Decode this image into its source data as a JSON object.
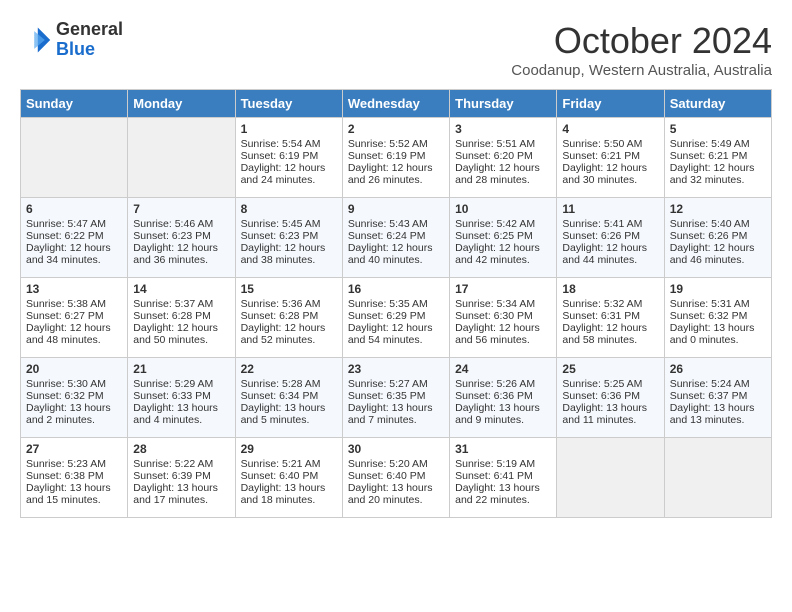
{
  "header": {
    "logo_line1": "General",
    "logo_line2": "Blue",
    "month_title": "October 2024",
    "subtitle": "Coodanup, Western Australia, Australia"
  },
  "days_of_week": [
    "Sunday",
    "Monday",
    "Tuesday",
    "Wednesday",
    "Thursday",
    "Friday",
    "Saturday"
  ],
  "weeks": [
    [
      {
        "day": "",
        "content": ""
      },
      {
        "day": "",
        "content": ""
      },
      {
        "day": "1",
        "content": "Sunrise: 5:54 AM\nSunset: 6:19 PM\nDaylight: 12 hours\nand 24 minutes."
      },
      {
        "day": "2",
        "content": "Sunrise: 5:52 AM\nSunset: 6:19 PM\nDaylight: 12 hours\nand 26 minutes."
      },
      {
        "day": "3",
        "content": "Sunrise: 5:51 AM\nSunset: 6:20 PM\nDaylight: 12 hours\nand 28 minutes."
      },
      {
        "day": "4",
        "content": "Sunrise: 5:50 AM\nSunset: 6:21 PM\nDaylight: 12 hours\nand 30 minutes."
      },
      {
        "day": "5",
        "content": "Sunrise: 5:49 AM\nSunset: 6:21 PM\nDaylight: 12 hours\nand 32 minutes."
      }
    ],
    [
      {
        "day": "6",
        "content": "Sunrise: 5:47 AM\nSunset: 6:22 PM\nDaylight: 12 hours\nand 34 minutes."
      },
      {
        "day": "7",
        "content": "Sunrise: 5:46 AM\nSunset: 6:23 PM\nDaylight: 12 hours\nand 36 minutes."
      },
      {
        "day": "8",
        "content": "Sunrise: 5:45 AM\nSunset: 6:23 PM\nDaylight: 12 hours\nand 38 minutes."
      },
      {
        "day": "9",
        "content": "Sunrise: 5:43 AM\nSunset: 6:24 PM\nDaylight: 12 hours\nand 40 minutes."
      },
      {
        "day": "10",
        "content": "Sunrise: 5:42 AM\nSunset: 6:25 PM\nDaylight: 12 hours\nand 42 minutes."
      },
      {
        "day": "11",
        "content": "Sunrise: 5:41 AM\nSunset: 6:26 PM\nDaylight: 12 hours\nand 44 minutes."
      },
      {
        "day": "12",
        "content": "Sunrise: 5:40 AM\nSunset: 6:26 PM\nDaylight: 12 hours\nand 46 minutes."
      }
    ],
    [
      {
        "day": "13",
        "content": "Sunrise: 5:38 AM\nSunset: 6:27 PM\nDaylight: 12 hours\nand 48 minutes."
      },
      {
        "day": "14",
        "content": "Sunrise: 5:37 AM\nSunset: 6:28 PM\nDaylight: 12 hours\nand 50 minutes."
      },
      {
        "day": "15",
        "content": "Sunrise: 5:36 AM\nSunset: 6:28 PM\nDaylight: 12 hours\nand 52 minutes."
      },
      {
        "day": "16",
        "content": "Sunrise: 5:35 AM\nSunset: 6:29 PM\nDaylight: 12 hours\nand 54 minutes."
      },
      {
        "day": "17",
        "content": "Sunrise: 5:34 AM\nSunset: 6:30 PM\nDaylight: 12 hours\nand 56 minutes."
      },
      {
        "day": "18",
        "content": "Sunrise: 5:32 AM\nSunset: 6:31 PM\nDaylight: 12 hours\nand 58 minutes."
      },
      {
        "day": "19",
        "content": "Sunrise: 5:31 AM\nSunset: 6:32 PM\nDaylight: 13 hours\nand 0 minutes."
      }
    ],
    [
      {
        "day": "20",
        "content": "Sunrise: 5:30 AM\nSunset: 6:32 PM\nDaylight: 13 hours\nand 2 minutes."
      },
      {
        "day": "21",
        "content": "Sunrise: 5:29 AM\nSunset: 6:33 PM\nDaylight: 13 hours\nand 4 minutes."
      },
      {
        "day": "22",
        "content": "Sunrise: 5:28 AM\nSunset: 6:34 PM\nDaylight: 13 hours\nand 5 minutes."
      },
      {
        "day": "23",
        "content": "Sunrise: 5:27 AM\nSunset: 6:35 PM\nDaylight: 13 hours\nand 7 minutes."
      },
      {
        "day": "24",
        "content": "Sunrise: 5:26 AM\nSunset: 6:36 PM\nDaylight: 13 hours\nand 9 minutes."
      },
      {
        "day": "25",
        "content": "Sunrise: 5:25 AM\nSunset: 6:36 PM\nDaylight: 13 hours\nand 11 minutes."
      },
      {
        "day": "26",
        "content": "Sunrise: 5:24 AM\nSunset: 6:37 PM\nDaylight: 13 hours\nand 13 minutes."
      }
    ],
    [
      {
        "day": "27",
        "content": "Sunrise: 5:23 AM\nSunset: 6:38 PM\nDaylight: 13 hours\nand 15 minutes."
      },
      {
        "day": "28",
        "content": "Sunrise: 5:22 AM\nSunset: 6:39 PM\nDaylight: 13 hours\nand 17 minutes."
      },
      {
        "day": "29",
        "content": "Sunrise: 5:21 AM\nSunset: 6:40 PM\nDaylight: 13 hours\nand 18 minutes."
      },
      {
        "day": "30",
        "content": "Sunrise: 5:20 AM\nSunset: 6:40 PM\nDaylight: 13 hours\nand 20 minutes."
      },
      {
        "day": "31",
        "content": "Sunrise: 5:19 AM\nSunset: 6:41 PM\nDaylight: 13 hours\nand 22 minutes."
      },
      {
        "day": "",
        "content": ""
      },
      {
        "day": "",
        "content": ""
      }
    ]
  ]
}
